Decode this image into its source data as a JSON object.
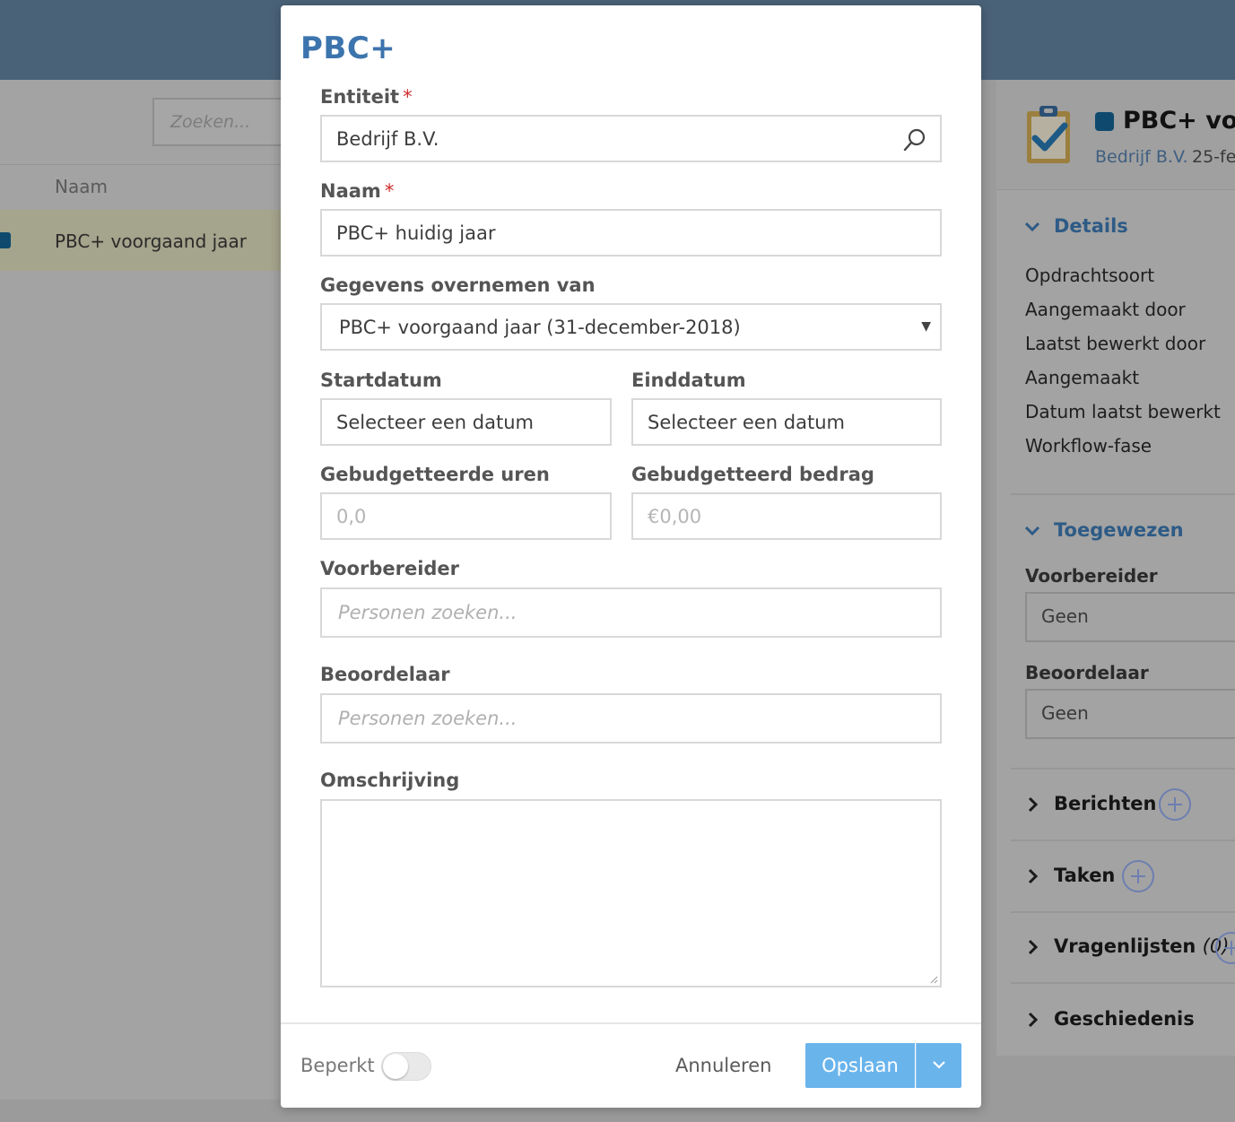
{
  "background": {
    "search_placeholder": "Zoeken...",
    "column_header": "Naam",
    "rows": [
      {
        "label": "PBC+ voorgaand jaar"
      }
    ],
    "panel": {
      "title": "PBC+ voo",
      "entity": "Bedrijf B.V.",
      "date": "25-fe",
      "details": {
        "title": "Details",
        "items": [
          "Opdrachtsoort",
          "Aangemaakt door",
          "Laatst bewerkt door",
          "Aangemaakt",
          "Datum laatst bewerkt",
          "Workflow-fase"
        ]
      },
      "assigned": {
        "title": "Toegewezen",
        "preparer_label": "Voorbereider",
        "preparer_value": "Geen",
        "reviewer_label": "Beoordelaar",
        "reviewer_value": "Geen"
      },
      "sections": {
        "messages": "Berichten",
        "tasks": "Taken",
        "questionnaires": "Vragenlijsten",
        "questionnaires_count": "(0)",
        "history": "Geschiedenis"
      }
    }
  },
  "modal": {
    "title": "PBC+",
    "required_mark": "*",
    "entity": {
      "label": "Entiteit",
      "value": "Bedrijf B.V."
    },
    "name": {
      "label": "Naam",
      "value": "PBC+ huidig jaar"
    },
    "copy_from": {
      "label": "Gegevens overnemen van",
      "value": "PBC+ voorgaand jaar (31-december-2018)"
    },
    "start_date": {
      "label": "Startdatum",
      "value": "Selecteer een datum"
    },
    "end_date": {
      "label": "Einddatum",
      "value": "Selecteer een datum"
    },
    "budget_hours": {
      "label": "Gebudgetteerde uren",
      "placeholder": "0,0"
    },
    "budget_amount": {
      "label": "Gebudgetteerd bedrag",
      "placeholder": "€0,00"
    },
    "preparer": {
      "label": "Voorbereider",
      "placeholder": "Personen zoeken..."
    },
    "reviewer": {
      "label": "Beoordelaar",
      "placeholder": "Personen zoeken..."
    },
    "description": {
      "label": "Omschrijving",
      "value": ""
    },
    "footer": {
      "restricted_label": "Beperkt",
      "restricted_on": false,
      "cancel_label": "Annuleren",
      "save_label": "Opslaan"
    }
  },
  "colors": {
    "topbar": "#4a6278",
    "title": "#3c74ad",
    "primary_button": "#6ab4ec",
    "required": "#d02a2a"
  }
}
